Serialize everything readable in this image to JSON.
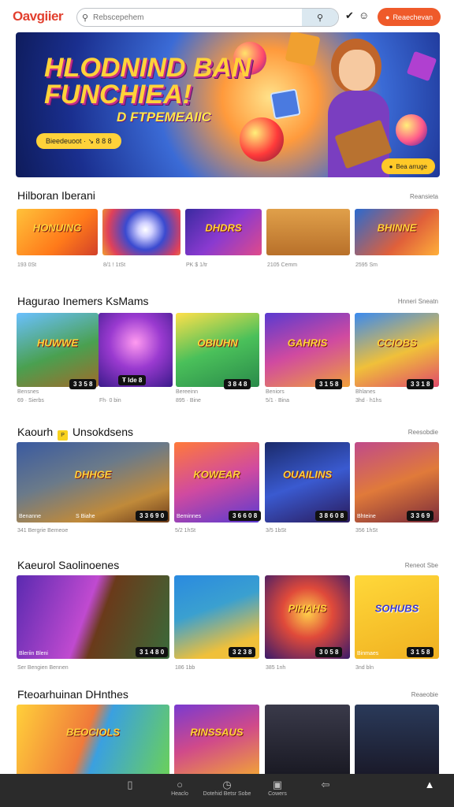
{
  "header": {
    "logo": "Oavgiier",
    "search_placeholder": "Rebscepehem",
    "signin_label": "Reaechevan"
  },
  "banner": {
    "title_line1": "HLODNIND BAN",
    "title_line2": "FUNCHIEA!",
    "subtitle": "D FTPEMEAIIC",
    "pill": "Bieedeuoot · ↘ 8 8 8",
    "cta": "Bea arruge"
  },
  "sections": [
    {
      "title": "Hilboran Iberani",
      "more": "Reansieta",
      "cards": [
        {
          "art": "HONUING",
          "meta": "193 0St"
        },
        {
          "art": "",
          "meta": "8/1 ! 1tSt"
        },
        {
          "art": "DHDRS",
          "meta": "PK $ 1/tr"
        },
        {
          "art": "",
          "meta": "2105 Cemm"
        },
        {
          "art": "BHINNE",
          "meta": "2595 Sm"
        }
      ]
    },
    {
      "title": "Hagurao Inemers KsMams",
      "more": "Hnneri Sneatn",
      "cards": [
        {
          "art": "HUWWE",
          "label": "Bensnes",
          "price": "3 3 5 8",
          "meta": "69 · Sierbs"
        },
        {
          "art": "",
          "label": "",
          "price": "Ŧ lde 8",
          "meta": "Fh· 0 bin"
        },
        {
          "art": "OBIUHN",
          "label": "Bereeinn",
          "price": "3 8 4 8",
          "meta": "895 · Bine"
        },
        {
          "art": "GAHRIS",
          "label": "Beniors",
          "price": "3 1 5 8",
          "meta": "5/1 · Bina"
        },
        {
          "art": "CCIOBS",
          "label": "Bhlanes",
          "price": "3 3 1 8",
          "meta": "3hd · h1hs"
        }
      ]
    },
    {
      "title": "Kaourh",
      "title_badge": "P",
      "title_rest": "Unsokdsens",
      "more": "Reesobdie",
      "cards": [
        {
          "art": "DHHGE",
          "label": "Benanne",
          "label2": "S Biahe",
          "price": "3 3 6 9 0",
          "meta": "341 Bergrie Bemeoe"
        },
        {
          "art": "KOWEAR",
          "label": "Beminnes",
          "price": "3 6 6 0 8",
          "meta": "5/2 1hSt"
        },
        {
          "art": "OUAILINS",
          "label": "",
          "price": "3 8 6 0 8",
          "meta": "3/5 1bSt"
        },
        {
          "art": "",
          "label": "Bhteine",
          "price": "3 3 6 9",
          "meta": "356 1hSt"
        }
      ]
    },
    {
      "title": "Kaeurol Saolinoenes",
      "more": "Reneot Sbe",
      "cards": [
        {
          "art": "",
          "label": "Bleriin Bleni",
          "price": "3 1 4 8 0",
          "meta": "Ser Bengien Bennen"
        },
        {
          "art": "",
          "label": "",
          "price": "3 2 3 8",
          "meta": "186 1bb"
        },
        {
          "art": "PIHAHS",
          "label": "",
          "price": "3 0 5 8",
          "meta": "385 1nh"
        },
        {
          "art": "SOHUBS",
          "label": "Binmaes",
          "price": "3 1 5 8",
          "meta": "3nd bln"
        }
      ]
    },
    {
      "title": "Fteoarhuinan DHnthes",
      "more": "Reaeobie",
      "cards": [
        {
          "art": "BEOCIOLS"
        },
        {
          "art": "RINSSAUS"
        },
        {
          "art": ""
        },
        {
          "art": ""
        }
      ]
    }
  ],
  "bottom_nav": [
    {
      "icon": "library-icon",
      "label": ""
    },
    {
      "icon": "chat-icon",
      "label": "Heaclo"
    },
    {
      "icon": "clock-icon",
      "label": "Dotehid Betsr Sobe"
    },
    {
      "icon": "store-icon",
      "label": "Cowers"
    },
    {
      "icon": "share-icon",
      "label": ""
    },
    {
      "icon": "profile-icon",
      "label": ""
    }
  ],
  "colors": {
    "accent": "#ef5a2a",
    "nav_bg": "#2b2b2b",
    "price_bg": "#111111",
    "badge_yellow": "#f8d21e"
  }
}
